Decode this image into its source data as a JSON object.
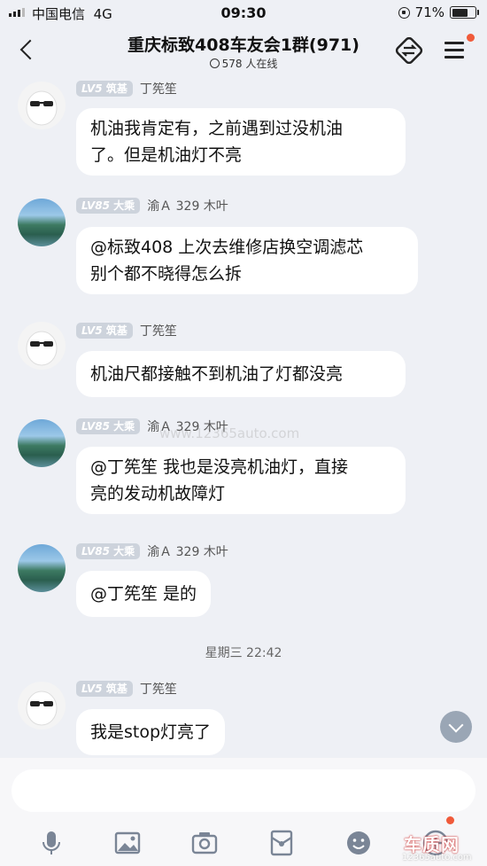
{
  "status_bar": {
    "carrier": "中国电信",
    "network": "4G",
    "time": "09:30",
    "battery": "71%",
    "battery_level": 0.71
  },
  "header": {
    "title": "重庆标致408车友会1群(971)",
    "online": "578 人在线"
  },
  "messages": [
    {
      "avatar": "ghost-cartoon-avatar",
      "lv": "LV5",
      "rank": "筑基",
      "sender": "丁筅笙",
      "text_lines": [
        "机油我肯定有，之前遇到过没机油",
        "了。但是机油灯不亮"
      ]
    },
    {
      "avatar": "lake-landscape-avatar",
      "lv": "LV85",
      "rank": "大乘",
      "sender": "渝Ａ 329 木叶",
      "text_lines": [
        "@标致408 上次去维修店换空调滤芯",
        "别个都不晓得怎么拆"
      ]
    },
    {
      "avatar": "ghost-cartoon-avatar",
      "lv": "LV5",
      "rank": "筑基",
      "sender": "丁筅笙",
      "text_lines": [
        "机油尺都接触不到机油了灯都没亮"
      ]
    },
    {
      "avatar": "lake-landscape-avatar",
      "lv": "LV85",
      "rank": "大乘",
      "sender": "渝Ａ 329 木叶",
      "text_lines": [
        "@丁筅笙 我也是没亮机油灯，直接",
        "亮的发动机故障灯"
      ]
    },
    {
      "avatar": "lake-landscape-avatar",
      "lv": "LV85",
      "rank": "大乘",
      "sender": "渝Ａ 329 木叶",
      "text_lines": [
        "@丁筅笙 是的"
      ]
    },
    {
      "avatar": "ghost-cartoon-avatar",
      "lv": "LV5",
      "rank": "筑基",
      "sender": "丁筅笙",
      "text_lines": [
        "我是stop灯亮了"
      ]
    }
  ],
  "timestamp": "星期三 22:42",
  "watermark": "www.12365auto.com",
  "input": {
    "placeholder": ""
  },
  "toolbar": [
    "mic-icon",
    "image-icon",
    "camera-icon",
    "red-packet-icon",
    "emoji-icon",
    "plus-icon"
  ],
  "logo_watermark": {
    "big": "车质网",
    "small": "12365auto.com"
  }
}
